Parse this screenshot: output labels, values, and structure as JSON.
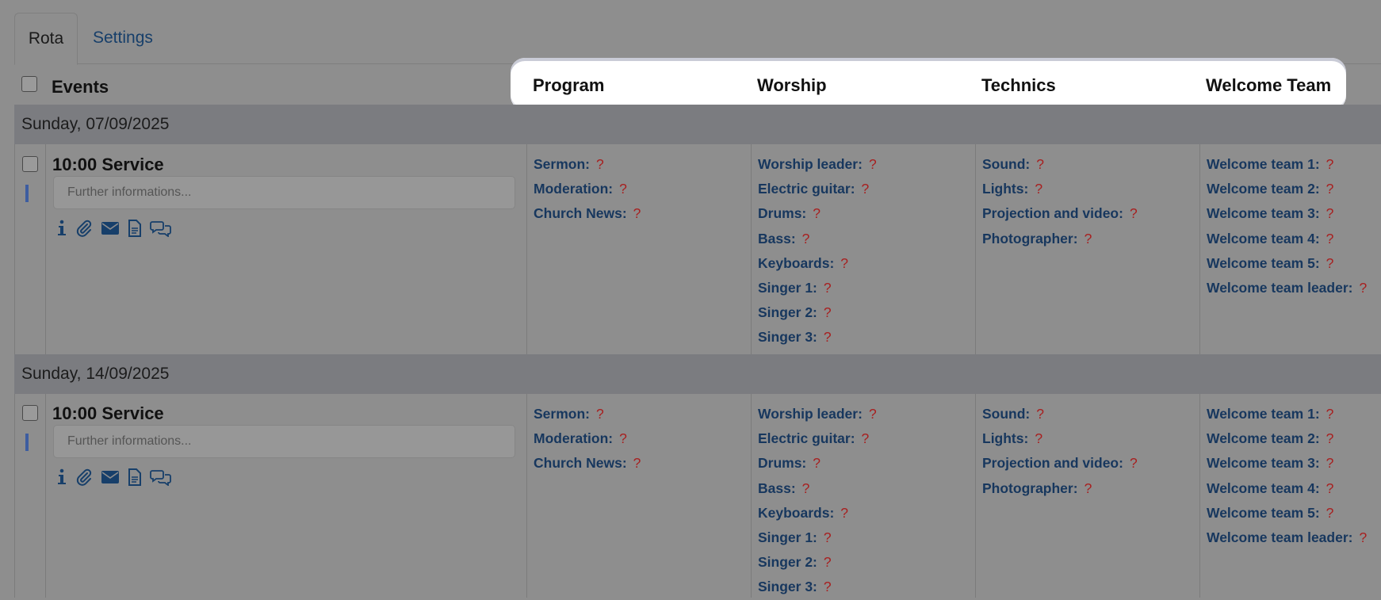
{
  "tabs": [
    {
      "label": "Rota"
    },
    {
      "label": "Settings"
    }
  ],
  "header": {
    "events_label": "Events",
    "columns": [
      "Program",
      "Worship",
      "Technics",
      "Welcome Team"
    ]
  },
  "sections": [
    {
      "date": "Sunday, 07/09/2025",
      "event_title": "10:00 Service",
      "info_placeholder": "Further informations...",
      "program": [
        "Sermon:",
        "Moderation:",
        "Church News:"
      ],
      "worship": [
        "Worship leader:",
        "Electric guitar:",
        "Drums:",
        "Bass:",
        "Keyboards:",
        "Singer 1:",
        "Singer 2:",
        "Singer 3:"
      ],
      "technics": [
        "Sound:",
        "Lights:",
        "Projection and video:",
        "Photographer:"
      ],
      "welcome": [
        "Welcome team 1:",
        "Welcome team 2:",
        "Welcome team 3:",
        "Welcome team 4:",
        "Welcome team 5:",
        "Welcome team leader:"
      ]
    },
    {
      "date": "Sunday, 14/09/2025",
      "event_title": "10:00 Service",
      "info_placeholder": "Further informations...",
      "program": [
        "Sermon:",
        "Moderation:",
        "Church News:"
      ],
      "worship": [
        "Worship leader:",
        "Electric guitar:",
        "Drums:",
        "Bass:",
        "Keyboards:",
        "Singer 1:",
        "Singer 2:",
        "Singer 3:"
      ],
      "technics": [
        "Sound:",
        "Lights:",
        "Projection and video:",
        "Photographer:"
      ],
      "welcome": [
        "Welcome team 1:",
        "Welcome team 2:",
        "Welcome team 3:",
        "Welcome team 4:",
        "Welcome team 5:",
        "Welcome team leader:"
      ]
    }
  ],
  "unassigned_mark": "?",
  "icons": [
    "info-icon",
    "paperclip-icon",
    "envelope-icon",
    "document-icon",
    "chat-icon"
  ],
  "colors": {
    "link": "#17375e",
    "unassigned": "#a81f1f",
    "date_bar": "#7b7c80",
    "highlight": "#ffffff"
  }
}
